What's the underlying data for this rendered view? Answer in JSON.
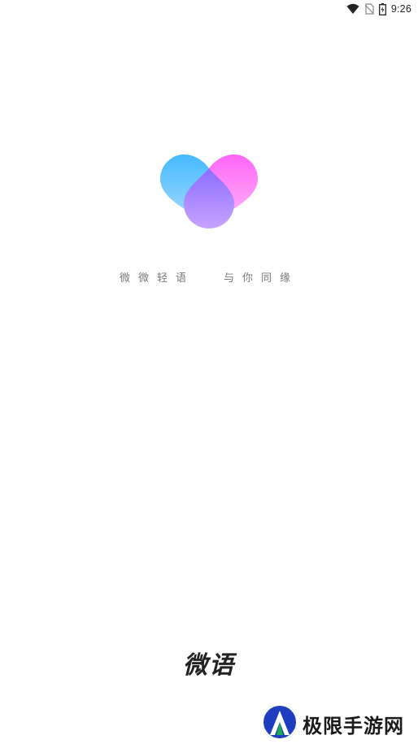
{
  "status_bar": {
    "time": "9:26",
    "icons": [
      "wifi-icon",
      "no-sim-icon",
      "battery-icon"
    ]
  },
  "logo": {
    "colors": {
      "left_top": "#3BB6FF",
      "left_bottom": "#9FD7FF",
      "right_top": "#FF5CF7",
      "right_bottom": "#FFB3F4",
      "center_top": "#8C6CFF",
      "center_bottom": "#C7A3FF"
    }
  },
  "tagline": {
    "part1": "微微轻语",
    "part2": "与你同缘"
  },
  "brand": {
    "title": "微语"
  },
  "watermark": {
    "text": "极限手游网",
    "colors": {
      "ring": "#1F3DBF",
      "accent": "#1BAE4B"
    }
  }
}
